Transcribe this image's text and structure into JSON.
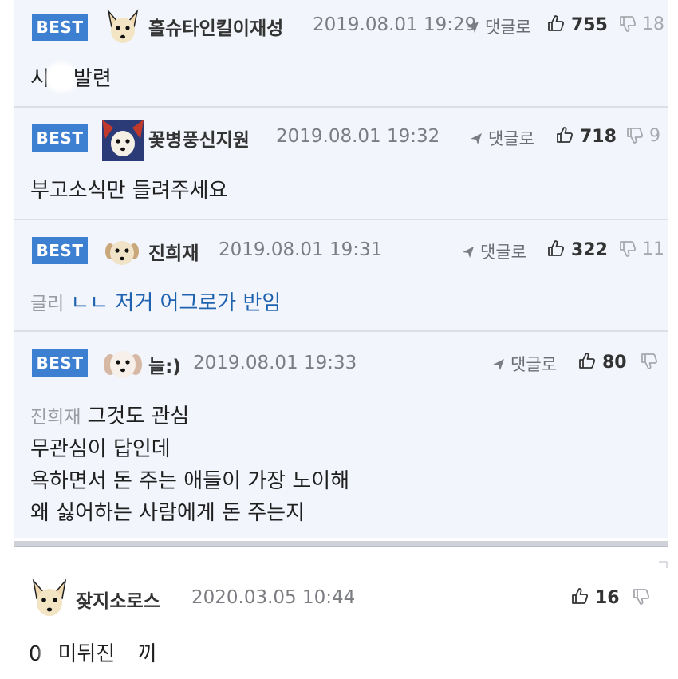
{
  "colors": {
    "best_bg": "#3d7fd1",
    "card_bg": "#f2f5fb",
    "link": "#1e62b0",
    "muted": "#7b7d82"
  },
  "comments": [
    {
      "best_label": "BEST",
      "avatar_icon": "chihuahua-avatar-icon",
      "nickname": "홀슈타인킬이재성",
      "date": "2019.08.01 19:29",
      "reply_label": "댓글로",
      "likes": "755",
      "dislikes": "18",
      "text_a": "시",
      "text_b": "발련"
    },
    {
      "best_label": "BEST",
      "avatar_icon": "dog-avatar-icon",
      "nickname": "꽃병풍신지원",
      "date": "2019.08.01 19:32",
      "reply_label": "댓글로",
      "likes": "718",
      "dislikes": "9",
      "text": "부고소식만 들려주세요"
    },
    {
      "best_label": "BEST",
      "avatar_icon": "puppy-avatar-icon",
      "nickname": "진희재",
      "date": "2019.08.01 19:31",
      "reply_label": "댓글로",
      "likes": "322",
      "dislikes": "11",
      "mention": "글리",
      "text": "ㄴㄴ 저거 어그로가 반임"
    },
    {
      "best_label": "BEST",
      "avatar_icon": "maltese-avatar-icon",
      "nickname": "늘:)",
      "date": "2019.08.01 19:33",
      "reply_label": "댓글로",
      "likes": "80",
      "dislikes": "",
      "mention": "진희재",
      "lines": [
        "그것도 관심",
        "무관심이 답인데",
        "욕하면서 돈 주는 애들이 가장 노이해",
        "왜 싫어하는 사람에게 돈 주는지"
      ]
    },
    {
      "avatar_icon": "chihuahua-avatar-icon",
      "nickname": "잦지소로스",
      "date": "2020.03.05 10:44",
      "likes": "16",
      "dislikes": "",
      "text_a": "0",
      "text_b": "미뒤진 ",
      "text_c": "끼"
    }
  ]
}
